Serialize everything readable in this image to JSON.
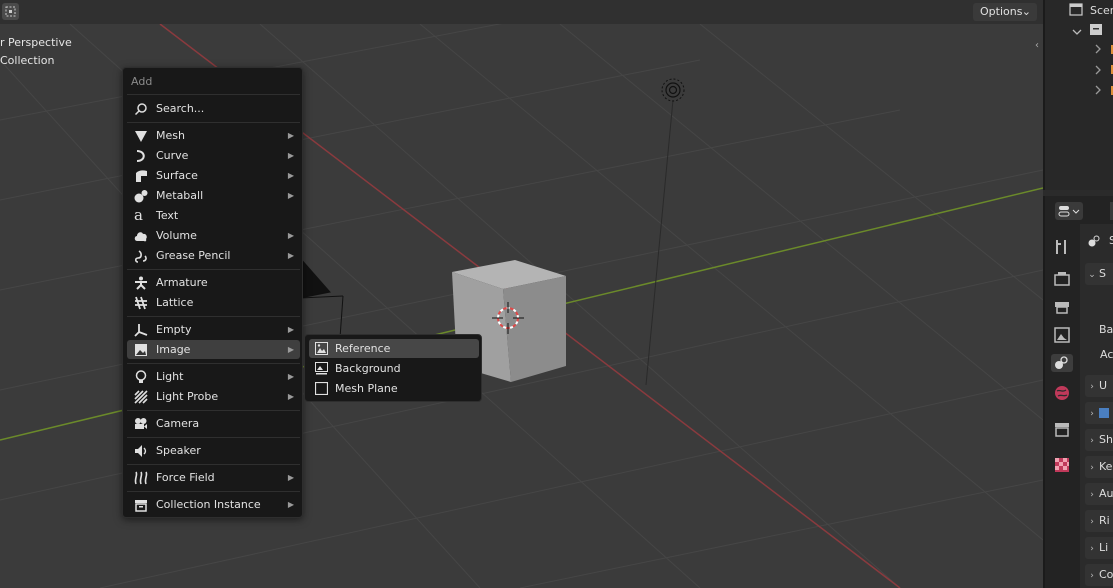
{
  "viewport": {
    "header": {
      "options_label": "Options",
      "options_chevron": "⌄"
    },
    "overlay_line1": "r Perspective",
    "overlay_line2": "Collection"
  },
  "add_menu": {
    "title": "Add",
    "search": "Search...",
    "items": [
      {
        "label": "Mesh",
        "icon": "mesh-icon",
        "has_submenu": true
      },
      {
        "label": "Curve",
        "icon": "curve-icon",
        "has_submenu": true
      },
      {
        "label": "Surface",
        "icon": "surface-icon",
        "has_submenu": true
      },
      {
        "label": "Metaball",
        "icon": "metaball-icon",
        "has_submenu": true
      },
      {
        "label": "Text",
        "icon": "text-icon",
        "has_submenu": false
      },
      {
        "label": "Volume",
        "icon": "volume-icon",
        "has_submenu": true
      },
      {
        "label": "Grease Pencil",
        "icon": "grease-pencil-icon",
        "has_submenu": true
      },
      {
        "label": "Armature",
        "icon": "armature-icon",
        "has_submenu": false
      },
      {
        "label": "Lattice",
        "icon": "lattice-icon",
        "has_submenu": false
      },
      {
        "label": "Empty",
        "icon": "empty-icon",
        "has_submenu": true
      },
      {
        "label": "Image",
        "icon": "image-icon",
        "has_submenu": true
      },
      {
        "label": "Light",
        "icon": "light-icon",
        "has_submenu": true
      },
      {
        "label": "Light Probe",
        "icon": "light-probe-icon",
        "has_submenu": true
      },
      {
        "label": "Camera",
        "icon": "camera-icon",
        "has_submenu": false
      },
      {
        "label": "Speaker",
        "icon": "speaker-icon",
        "has_submenu": false
      },
      {
        "label": "Force Field",
        "icon": "force-field-icon",
        "has_submenu": true
      },
      {
        "label": "Collection Instance",
        "icon": "collection-instance-icon",
        "has_submenu": true
      }
    ]
  },
  "image_submenu": {
    "items": [
      "Reference",
      "Background",
      "Mesh Plane"
    ],
    "active": "Reference"
  },
  "outliner": {
    "scene_label": "Scen"
  },
  "properties": {
    "panel_labels": [
      "S",
      "U",
      "",
      "Sh",
      "Ke",
      "Au",
      "Ri",
      "Li",
      "Co"
    ],
    "text_rows": [
      "Bac",
      "Ac"
    ],
    "header_label": "S"
  },
  "colors": {
    "x_axis": "#8a3a3e",
    "y_axis": "#6b8a2a",
    "grid": "#454545",
    "menu_bg": "#181818",
    "highlight": "#3f3f3f"
  }
}
